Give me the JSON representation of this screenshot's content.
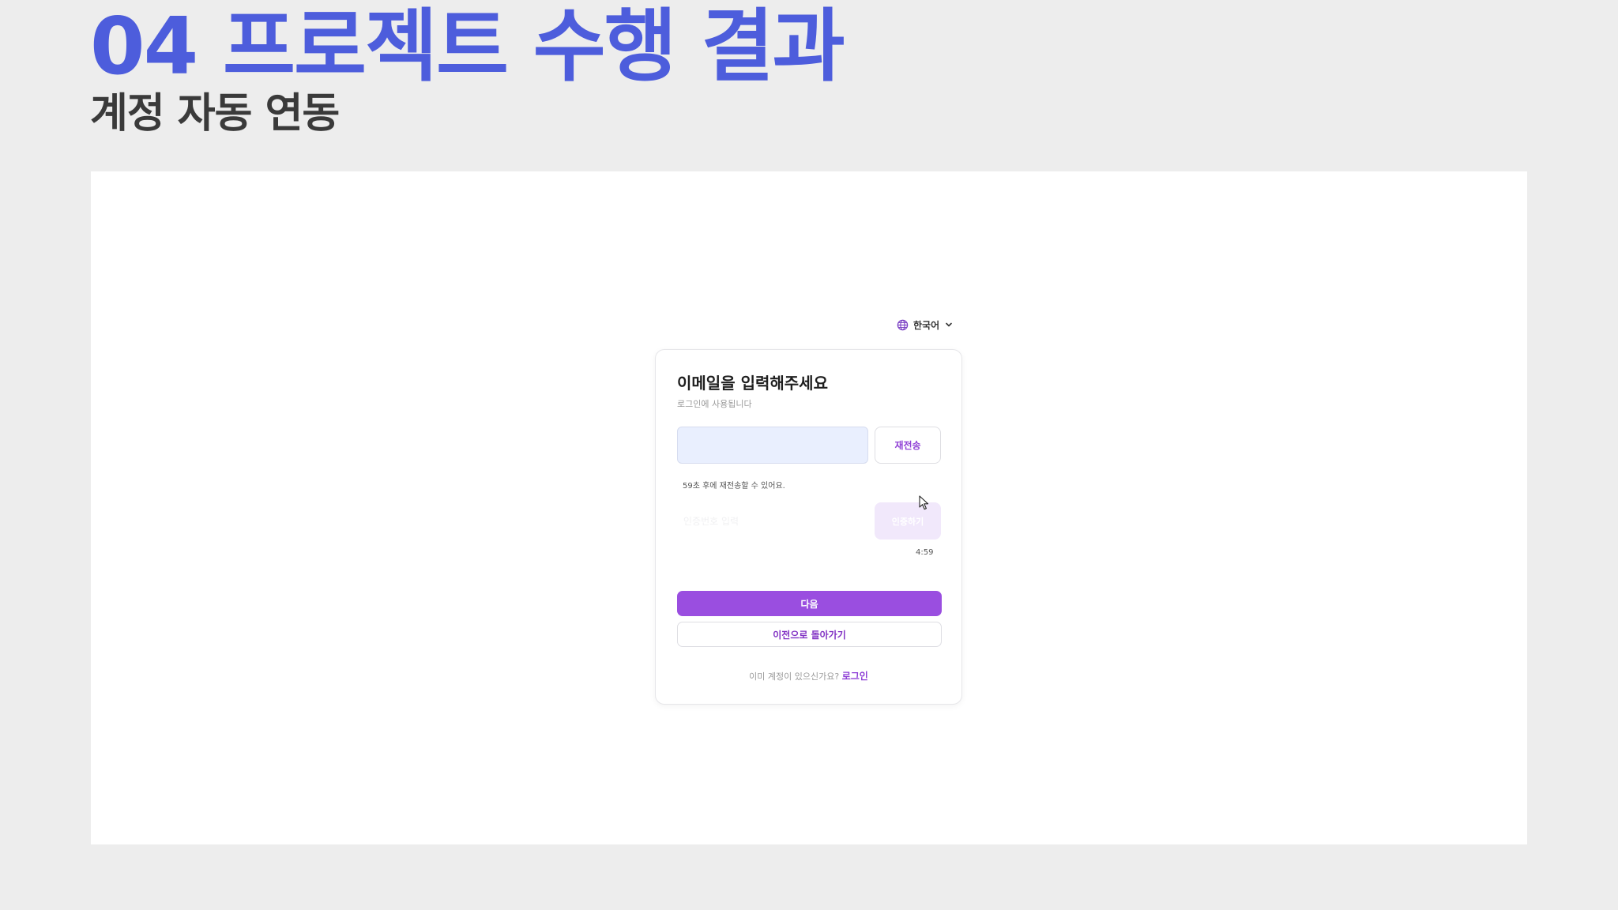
{
  "slide": {
    "title": "04 프로젝트 수행 결과",
    "subtitle": "계정 자동 연동"
  },
  "language": {
    "icon": "globe-icon",
    "label": "한국어",
    "chevron": "chevron-down-icon"
  },
  "form": {
    "title": "이메일을 입력해주세요",
    "subtitle": "로그인에 사용됩니다",
    "email_value": "",
    "resend_label": "재전송",
    "resend_note": "59초 후에 재전송할 수 있어요.",
    "code_placeholder": "인증번호 입력",
    "verify_label": "인증하기",
    "timer": "4:59",
    "next_label": "다음",
    "back_label": "이전으로 돌아가기",
    "login_prompt": "이미 계정이 있으신가요?",
    "login_link": "로그인"
  },
  "colors": {
    "title": "#4d5ddc",
    "accent": "#9a4ee0",
    "accent_light": "#f1e8fb",
    "input_fill": "#e9effe"
  }
}
